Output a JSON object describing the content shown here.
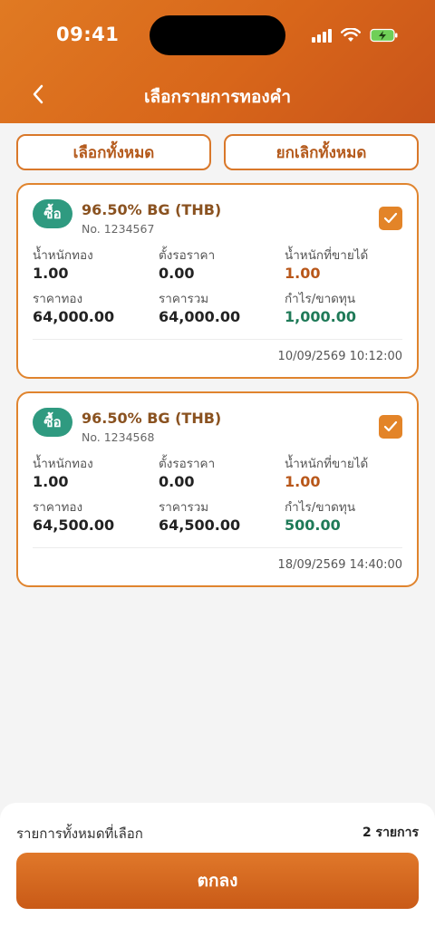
{
  "status_bar": {
    "time": "09:41"
  },
  "header": {
    "title": "เลือกรายการทองคำ"
  },
  "actions": {
    "select_all": "เลือกทั้งหมด",
    "deselect_all": "ยกเลิกทั้งหมด"
  },
  "labels": {
    "gold_weight": "น้ำหนักทอง",
    "pending_price": "ตั้งรอราคา",
    "sellable_weight": "น้ำหนักที่ขายได้",
    "gold_price": "ราคาทอง",
    "total_price": "ราคารวม",
    "profit_loss": "กำไร/ขาดทุน"
  },
  "items": [
    {
      "type": "ซื้อ",
      "title": "96.50% BG (THB)",
      "number": "No. 1234567",
      "gold_weight": "1.00",
      "pending_price": "0.00",
      "sellable_weight": "1.00",
      "gold_price": "64,000.00",
      "total_price": "64,000.00",
      "profit_loss": "1,000.00",
      "datetime": "10/09/2569 10:12:00",
      "checked": true
    },
    {
      "type": "ซื้อ",
      "title": "96.50% BG (THB)",
      "number": "No. 1234568",
      "gold_weight": "1.00",
      "pending_price": "0.00",
      "sellable_weight": "1.00",
      "gold_price": "64,500.00",
      "total_price": "64,500.00",
      "profit_loss": "500.00",
      "datetime": "18/09/2569 14:40:00",
      "checked": true
    }
  ],
  "summary": {
    "label": "รายการทั้งหมดที่เลือก",
    "count": "2 รายการ"
  },
  "confirm": {
    "label": "ตกลง"
  },
  "colors": {
    "accent": "#e0782a",
    "buy_badge": "#2f9a80",
    "profit": "#1f7a58",
    "sellable": "#b8571a"
  }
}
